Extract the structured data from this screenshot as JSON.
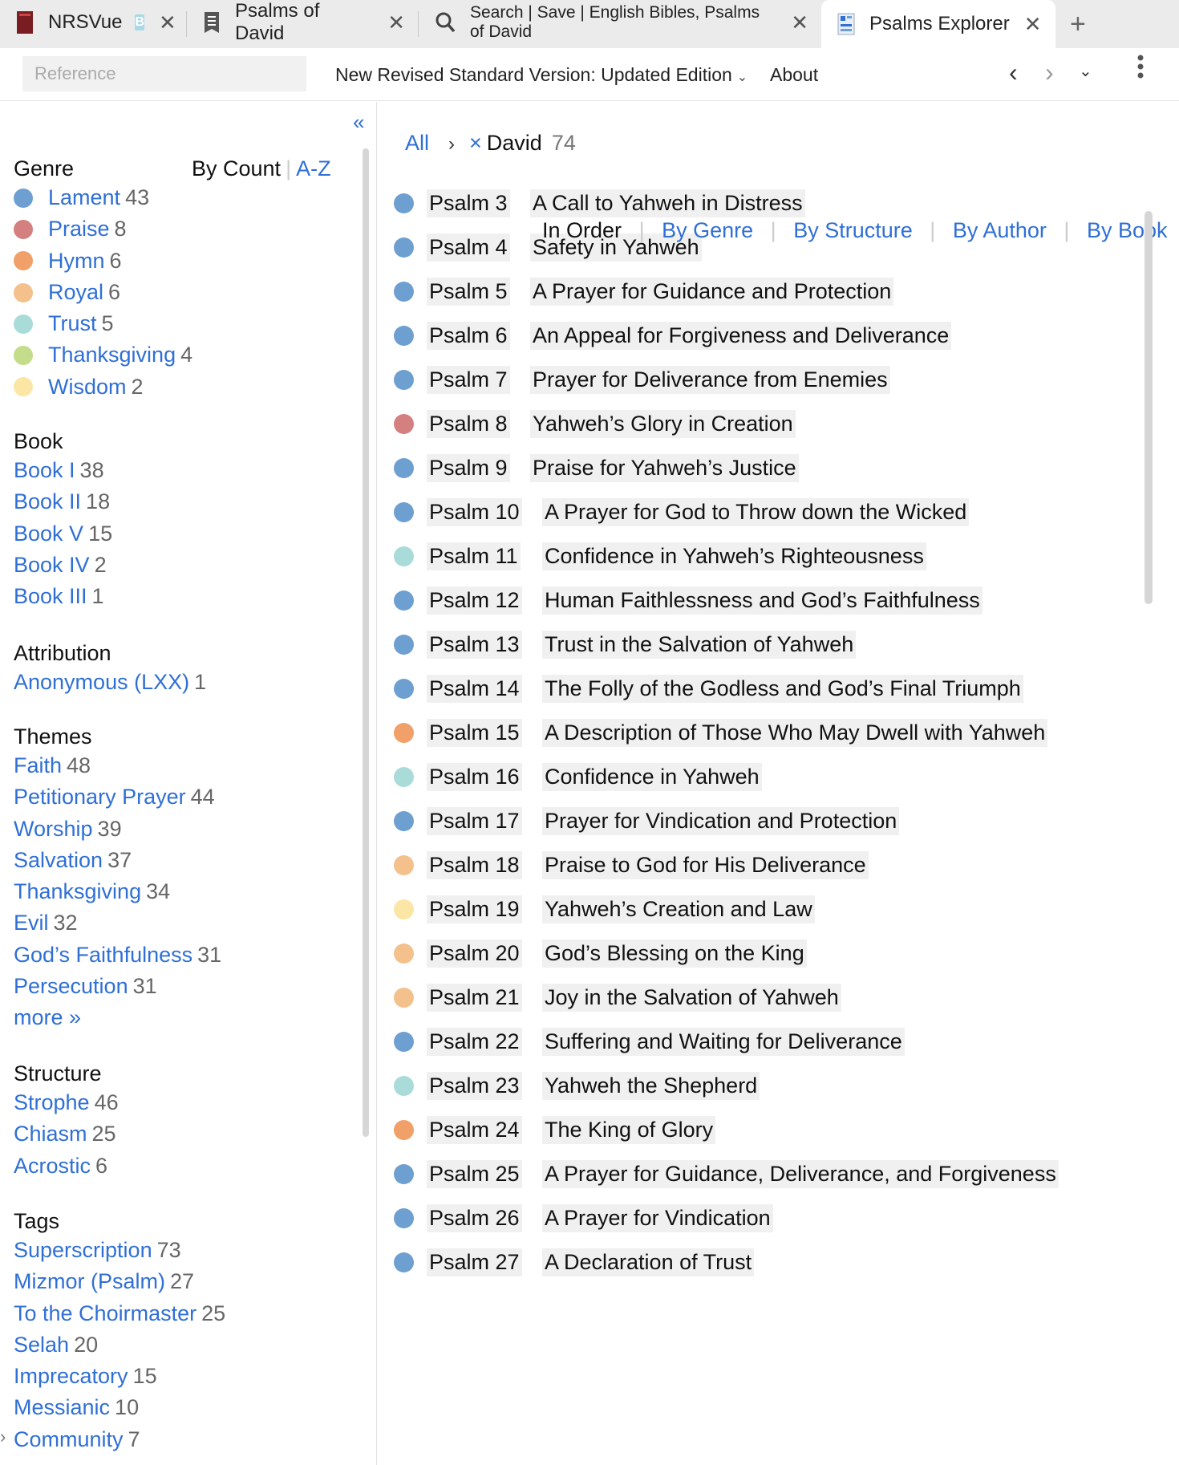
{
  "tabs": [
    {
      "label": "NRSVue",
      "badge": "B",
      "close": "✕"
    },
    {
      "label": "Psalms of David",
      "close": "✕"
    },
    {
      "label": "Search | Save | English Bibles, Psalms of David",
      "close": "✕"
    },
    {
      "label": "Psalms Explorer",
      "close": "✕"
    }
  ],
  "tab_add": "+",
  "toolbar": {
    "reference_placeholder": "Reference",
    "version": "New Revised Standard Version: Updated Edition",
    "about": "About",
    "back": "‹",
    "forward": "›",
    "history_dropdown": "⌄",
    "menu": "⋮",
    "version_caret": "⌄"
  },
  "sidebar": {
    "collapse": "«",
    "sort": {
      "by_count": "By Count",
      "az": "A-Z"
    },
    "genre": {
      "title": "Genre",
      "items": [
        {
          "label": "Lament",
          "count": "43",
          "color": "#6e9fd1"
        },
        {
          "label": "Praise",
          "count": "8",
          "color": "#d48080"
        },
        {
          "label": "Hymn",
          "count": "6",
          "color": "#f0a068"
        },
        {
          "label": "Royal",
          "count": "6",
          "color": "#f4c08c"
        },
        {
          "label": "Trust",
          "count": "5",
          "color": "#a9dcd9"
        },
        {
          "label": "Thanksgiving",
          "count": "4",
          "color": "#c4dd8a"
        },
        {
          "label": "Wisdom",
          "count": "2",
          "color": "#fbe6a6"
        }
      ]
    },
    "book": {
      "title": "Book",
      "items": [
        {
          "label": "Book I",
          "count": "38"
        },
        {
          "label": "Book II",
          "count": "18"
        },
        {
          "label": "Book V",
          "count": "15"
        },
        {
          "label": "Book IV",
          "count": "2"
        },
        {
          "label": "Book III",
          "count": "1"
        }
      ]
    },
    "attribution": {
      "title": "Attribution",
      "items": [
        {
          "label": "Anonymous (LXX)",
          "count": "1"
        }
      ]
    },
    "themes": {
      "title": "Themes",
      "items": [
        {
          "label": "Faith",
          "count": "48"
        },
        {
          "label": "Petitionary Prayer",
          "count": "44"
        },
        {
          "label": "Worship",
          "count": "39"
        },
        {
          "label": "Salvation",
          "count": "37"
        },
        {
          "label": "Thanksgiving",
          "count": "34"
        },
        {
          "label": "Evil",
          "count": "32"
        },
        {
          "label": "God’s Faithfulness",
          "count": "31"
        },
        {
          "label": "Persecution",
          "count": "31"
        }
      ],
      "more": "more »"
    },
    "structure": {
      "title": "Structure",
      "items": [
        {
          "label": "Strophe",
          "count": "46"
        },
        {
          "label": "Chiasm",
          "count": "25"
        },
        {
          "label": "Acrostic",
          "count": "6"
        }
      ]
    },
    "tags": {
      "title": "Tags",
      "items": [
        {
          "label": "Superscription",
          "count": "73"
        },
        {
          "label": "Mizmor (Psalm)",
          "count": "27"
        },
        {
          "label": "To the Choirmaster",
          "count": "25"
        },
        {
          "label": "Selah",
          "count": "20"
        },
        {
          "label": "Imprecatory",
          "count": "15"
        },
        {
          "label": "Messianic",
          "count": "10"
        },
        {
          "label": "Community",
          "count": "7"
        }
      ]
    },
    "expand_chevron": "›"
  },
  "main": {
    "breadcrumb": {
      "all": "All",
      "chevron": "›",
      "remove": "×",
      "filter": "David",
      "count": "74"
    },
    "views": {
      "in_order": "In Order",
      "by_genre": "By Genre",
      "by_structure": "By Structure",
      "by_author": "By Author",
      "by_book": "By Book"
    },
    "psalms": [
      {
        "ref": "Psalm 3",
        "title": "A Call to Yahweh in Distress",
        "color": "#6e9fd1"
      },
      {
        "ref": "Psalm 4",
        "title": "Safety in Yahweh",
        "color": "#6e9fd1"
      },
      {
        "ref": "Psalm 5",
        "title": "A Prayer for Guidance and Protection",
        "color": "#6e9fd1"
      },
      {
        "ref": "Psalm 6",
        "title": "An Appeal for Forgiveness and Deliverance",
        "color": "#6e9fd1"
      },
      {
        "ref": "Psalm 7",
        "title": "Prayer for Deliverance from Enemies",
        "color": "#6e9fd1"
      },
      {
        "ref": "Psalm 8",
        "title": "Yahweh’s Glory in Creation",
        "color": "#d48080"
      },
      {
        "ref": "Psalm 9",
        "title": "Praise for Yahweh’s Justice",
        "color": "#6e9fd1"
      },
      {
        "ref": "Psalm 10",
        "title": "A Prayer for God to Throw down the Wicked",
        "color": "#6e9fd1"
      },
      {
        "ref": "Psalm 11",
        "title": "Confidence in Yahweh’s Righteousness",
        "color": "#a9dcd9"
      },
      {
        "ref": "Psalm 12",
        "title": "Human Faithlessness and God’s Faithfulness",
        "color": "#6e9fd1"
      },
      {
        "ref": "Psalm 13",
        "title": "Trust in the Salvation of Yahweh",
        "color": "#6e9fd1"
      },
      {
        "ref": "Psalm 14",
        "title": "The Folly of the Godless and God’s Final Triumph",
        "color": "#6e9fd1"
      },
      {
        "ref": "Psalm 15",
        "title": "A Description of Those Who May Dwell with Yahweh",
        "color": "#f0a068"
      },
      {
        "ref": "Psalm 16",
        "title": "Confidence in Yahweh",
        "color": "#a9dcd9"
      },
      {
        "ref": "Psalm 17",
        "title": "Prayer for Vindication and Protection",
        "color": "#6e9fd1"
      },
      {
        "ref": "Psalm 18",
        "title": "Praise to God for His Deliverance",
        "color": "#f4c08c"
      },
      {
        "ref": "Psalm 19",
        "title": "Yahweh’s Creation and Law",
        "color": "#fbe6a6"
      },
      {
        "ref": "Psalm 20",
        "title": "God’s Blessing on the King",
        "color": "#f4c08c"
      },
      {
        "ref": "Psalm 21",
        "title": "Joy in the Salvation of Yahweh",
        "color": "#f4c08c"
      },
      {
        "ref": "Psalm 22",
        "title": "Suffering and Waiting for Deliverance",
        "color": "#6e9fd1"
      },
      {
        "ref": "Psalm 23",
        "title": "Yahweh the Shepherd",
        "color": "#a9dcd9"
      },
      {
        "ref": "Psalm 24",
        "title": "The King of Glory",
        "color": "#f0a068"
      },
      {
        "ref": "Psalm 25",
        "title": "A Prayer for Guidance, Deliverance, and Forgiveness",
        "color": "#6e9fd1"
      },
      {
        "ref": "Psalm 26",
        "title": "A Prayer for Vindication",
        "color": "#6e9fd1"
      },
      {
        "ref": "Psalm 27",
        "title": "A Declaration of Trust",
        "color": "#6e9fd1"
      }
    ]
  }
}
